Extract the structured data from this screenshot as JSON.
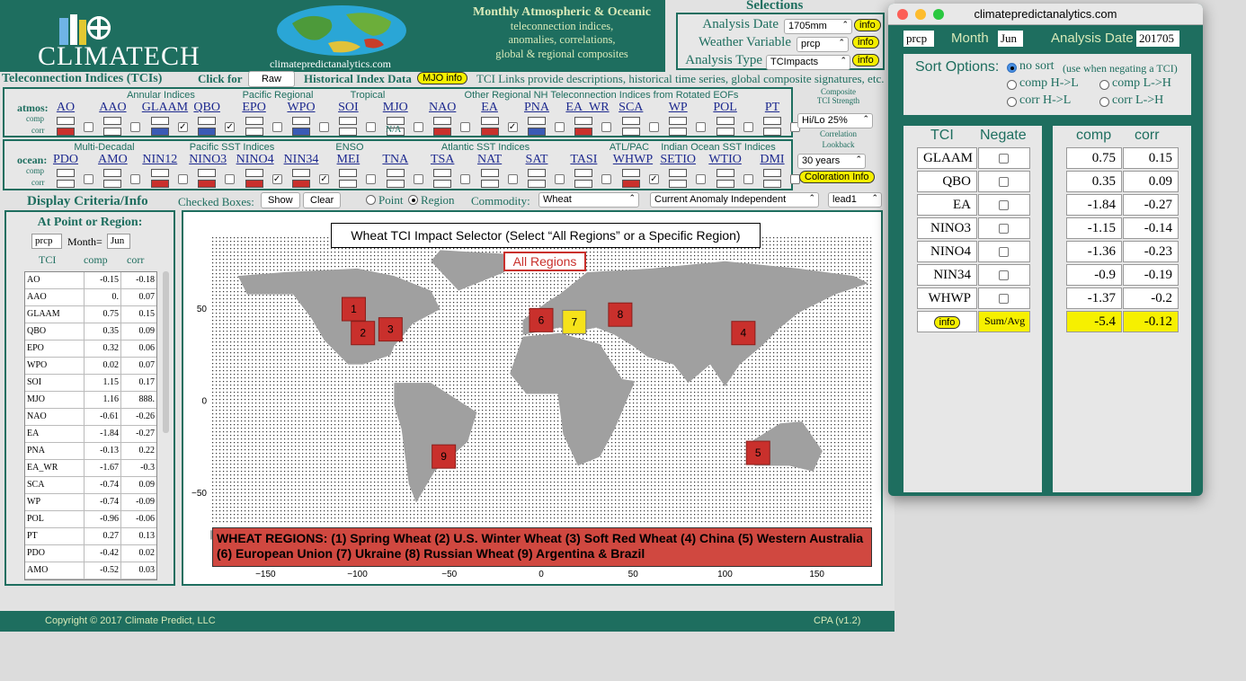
{
  "brand": {
    "name": "CLIMATECH",
    "url": "climatepredictanalytics.com"
  },
  "header": {
    "title": "Monthly Atmospheric & Oceanic",
    "line2": "teleconnection indices,",
    "line3": "anomalies, correlations,",
    "line4": "global & regional composites"
  },
  "selections": {
    "title": "Selections",
    "analysis_date_label": "Analysis Date",
    "analysis_date": "1705mm",
    "weather_variable_label": "Weather Variable",
    "weather_variable": "prcp",
    "analysis_type_label": "Analysis Type",
    "analysis_type": "TCImpacts",
    "info": "info"
  },
  "tci_bar": {
    "title": "Teleconnection Indices (TCIs)",
    "click_for": "Click for",
    "raw_button": "Raw",
    "historical": "Historical Index Data",
    "mjo_info": "MJO info",
    "links_text": "TCI Links provide descriptions, historical time series, global composite signatures, etc."
  },
  "atmos": {
    "row_label": "atmos:",
    "comp": "comp",
    "corr": "corr",
    "groups": [
      "Annular Indices",
      "Pacific Regional",
      "Tropical",
      "Other Regional NH Teleconnection Indices from Rotated EOFs"
    ],
    "indices": [
      "AO",
      "AAO",
      "GLAAM",
      "QBO",
      "EPO",
      "WPO",
      "SOI",
      "MJO",
      "NAO",
      "EA",
      "PNA",
      "EA_WR",
      "SCA",
      "WP",
      "POL",
      "PT"
    ],
    "mjo_na": "N/A"
  },
  "ocean": {
    "row_label": "ocean:",
    "comp": "comp",
    "corr": "corr",
    "groups": [
      "Multi-Decadal",
      "Pacific SST Indices",
      "ENSO",
      "Atlantic SST Indices",
      "ATL/PAC",
      "Indian Ocean SST Indices"
    ],
    "indices": [
      "PDO",
      "AMO",
      "NIN12",
      "NINO3",
      "NINO4",
      "NIN34",
      "MEI",
      "TNA",
      "TSA",
      "NAT",
      "SAT",
      "TASI",
      "WHWP",
      "SETIO",
      "WTIO",
      "DMI"
    ]
  },
  "composite": {
    "label1": "Composite",
    "label2": "TCI Strength",
    "strength": "Hi/Lo 25%",
    "label3": "Correlation",
    "label4": "Lookback",
    "lookback": "30 years",
    "coloration": "Coloration Info"
  },
  "criteria": {
    "title": "Display Criteria/Info",
    "checked_boxes": "Checked Boxes:",
    "show": "Show",
    "clear": "Clear",
    "point": "Point",
    "region": "Region",
    "commodity_label": "Commodity:",
    "commodity": "Wheat",
    "anomaly": "Current Anomaly Independent",
    "lead": "lead1"
  },
  "left": {
    "title": "At Point or Region:",
    "var": "prcp",
    "month_label": "Month=",
    "month": "Jun",
    "col_tci": "TCI",
    "col_comp": "comp",
    "col_corr": "corr",
    "rows": [
      [
        "AO",
        "-0.15",
        "-0.18"
      ],
      [
        "AAO",
        "0.",
        "0.07"
      ],
      [
        "GLAAM",
        "0.75",
        "0.15"
      ],
      [
        "QBO",
        "0.35",
        "0.09"
      ],
      [
        "EPO",
        "0.32",
        "0.06"
      ],
      [
        "WPO",
        "0.02",
        "0.07"
      ],
      [
        "SOI",
        "1.15",
        "0.17"
      ],
      [
        "MJO",
        "1.16",
        "888."
      ],
      [
        "NAO",
        "-0.61",
        "-0.26"
      ],
      [
        "EA",
        "-1.84",
        "-0.27"
      ],
      [
        "PNA",
        "-0.13",
        "0.22"
      ],
      [
        "EA_WR",
        "-1.67",
        "-0.3"
      ],
      [
        "SCA",
        "-0.74",
        "0.09"
      ],
      [
        "WP",
        "-0.74",
        "-0.09"
      ],
      [
        "POL",
        "-0.96",
        "-0.06"
      ],
      [
        "PT",
        "0.27",
        "0.13"
      ],
      [
        "PDO",
        "-0.42",
        "0.02"
      ],
      [
        "AMO",
        "-0.52",
        "0.03"
      ]
    ]
  },
  "map": {
    "title": "Wheat TCI Impact Selector (Select “All Regions” or a Specific Region)",
    "all_regions": "All Regions",
    "legend": "WHEAT REGIONS: (1) Spring Wheat  (2) U.S. Winter Wheat  (3) Soft Red Wheat  (4) China  (5) Western Australia (6) European Union  (7) Ukraine  (8) Russian Wheat  (9) Argentina & Brazil",
    "xticks": [
      "−150",
      "−100",
      "−50",
      "0",
      "50",
      "100",
      "150"
    ],
    "yticks": [
      "50",
      "0",
      "−50"
    ],
    "regions": [
      "1",
      "2",
      "3",
      "4",
      "5",
      "6",
      "7",
      "8",
      "9"
    ]
  },
  "footer": {
    "copyright": "Copyright © 2017 Climate Predict, LLC",
    "version": "CPA (v1.2)"
  },
  "popup": {
    "window_title": "climatepredictanalytics.com",
    "var": "prcp",
    "month_label": "Month",
    "month": "Jun",
    "date_label": "Analysis Date",
    "date": "201705",
    "sort_title": "Sort Options:",
    "sort_opts": [
      "no sort",
      "(use when negating a TCI)",
      "comp H->L",
      "comp L->H",
      "corr H->L",
      "corr L->H"
    ],
    "col_tci": "TCI",
    "col_negate": "Negate",
    "col_comp": "comp",
    "col_corr": "corr",
    "rows": [
      [
        "GLAAM",
        "0.75",
        "0.15"
      ],
      [
        "QBO",
        "0.35",
        "0.09"
      ],
      [
        "EA",
        "-1.84",
        "-0.27"
      ],
      [
        "NINO3",
        "-1.15",
        "-0.14"
      ],
      [
        "NINO4",
        "-1.36",
        "-0.23"
      ],
      [
        "NIN34",
        "-0.9",
        "-0.19"
      ],
      [
        "WHWP",
        "-1.37",
        "-0.2"
      ]
    ],
    "info": "info",
    "sum_label": "Sum/Avg",
    "sum_comp": "-5.4",
    "sum_corr": "-0.12"
  }
}
